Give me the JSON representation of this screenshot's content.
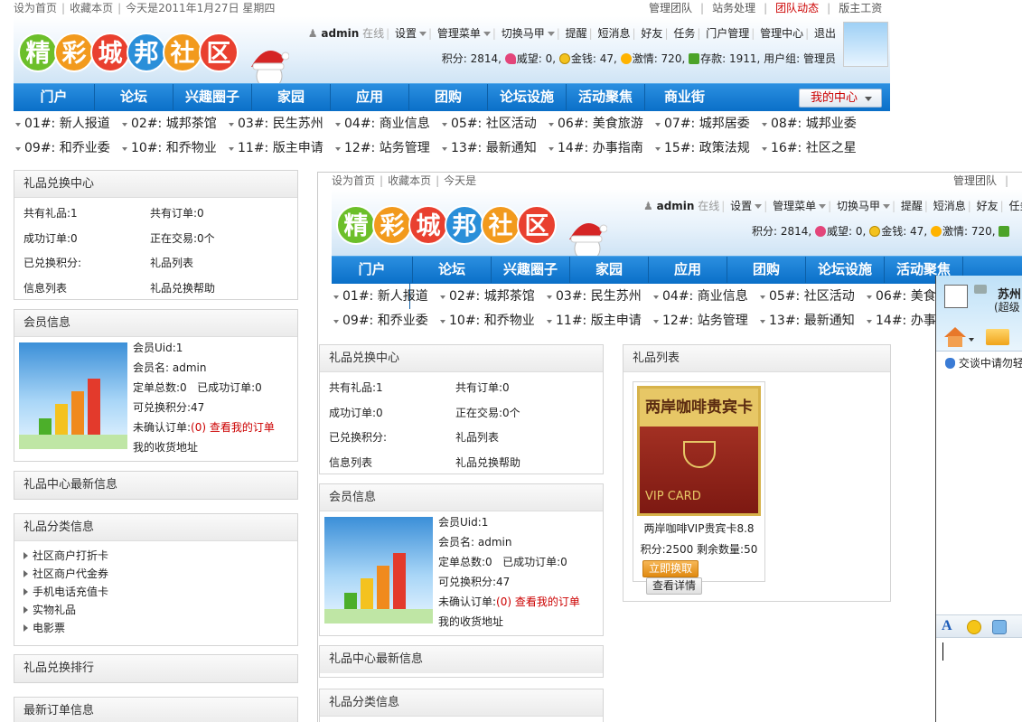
{
  "top_links": {
    "home": "设为首页",
    "favorite": "收藏本页",
    "today": "今天是2011年1月27日 星期四",
    "today_short": "今天是"
  },
  "top_right": [
    "管理团队",
    "站务处理",
    "团队动态",
    "版主工资"
  ],
  "logo_chars": [
    "精",
    "彩",
    "城",
    "邦",
    "社",
    "区"
  ],
  "user": {
    "name": "admin",
    "status": "在线",
    "menu": [
      "设置",
      "管理菜单",
      "切换马甲",
      "提醒",
      "短消息",
      "好友",
      "任务",
      "门户管理",
      "管理中心",
      "退出"
    ]
  },
  "stats": {
    "score": "积分: 2814",
    "prestige": "威望: 0",
    "money": "金钱: 47",
    "passion": "激情: 720",
    "savings": "存款: 1911",
    "group": "用户组: 管理员"
  },
  "nav": [
    "门户",
    "论坛",
    "兴趣圈子",
    "家园",
    "应用",
    "团购",
    "论坛设施",
    "活动聚焦",
    "商业街"
  ],
  "my_center": "我的中心",
  "subnav_row1": [
    "01#: 新人报道",
    "02#: 城邦茶馆",
    "03#: 民生苏州",
    "04#: 商业信息",
    "05#: 社区活动",
    "06#: 美食旅游",
    "07#: 城邦居委",
    "08#: 城邦业委"
  ],
  "subnav_row2": [
    "09#: 和乔业委",
    "10#: 和乔物业",
    "11#: 版主申请",
    "12#: 站务管理",
    "13#: 最新通知",
    "14#: 办事指南",
    "15#: 政策法规",
    "16#: 社区之星"
  ],
  "gift_center": {
    "title": "礼品兑换中心",
    "total_gifts": "共有礼品:1",
    "total_orders": "共有订单:0",
    "success_orders": "成功订单:0",
    "trading": "正在交易:0个",
    "redeemed_points": "已兑换积分:",
    "gift_list": "礼品列表",
    "info_list": "信息列表",
    "help": "礼品兑换帮助"
  },
  "member": {
    "title": "会员信息",
    "uid": "会员Uid:1",
    "name": "会员名: admin",
    "orders": "定单总数:0",
    "success": "已成功订单:0",
    "points": "可兑换积分:47",
    "unconfirmed": "未确认订单:",
    "unconfirmed_link": "(0) 查看我的订单",
    "address": "我的收货地址"
  },
  "latest_info": "礼品中心最新信息",
  "categories": {
    "title": "礼品分类信息",
    "items": [
      "社区商户打折卡",
      "社区商户代金券",
      "手机电话充值卡",
      "实物礼品",
      "电影票"
    ]
  },
  "ranking": "礼品兑换排行",
  "latest_orders": "最新订单信息",
  "gift_list_panel": {
    "title": "礼品列表",
    "card_title": "两岸咖啡贵宾卡",
    "card_sub": "VIP CARD",
    "item_name": "两岸咖啡VIP贵宾卡8.8",
    "item_price": "积分:2500 剩余数量:50",
    "redeem": "立即换取",
    "details": "查看详情"
  },
  "qq": {
    "name": "苏州",
    "sub": "(超级",
    "notice": "交谈中请勿轻"
  },
  "colors": {
    "nav": "#0a6fc8",
    "logo": [
      "#6cbf2a",
      "#f29a1d",
      "#e9402f",
      "#2a8fd9",
      "#f29a1d",
      "#e9402f"
    ]
  }
}
